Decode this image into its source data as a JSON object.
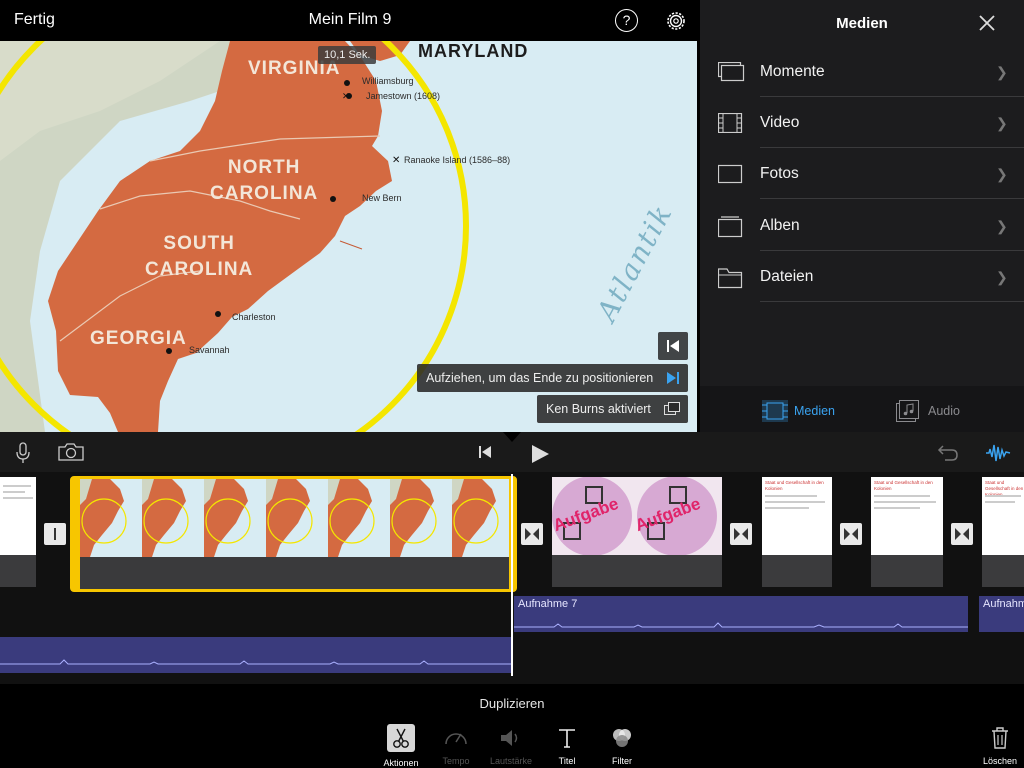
{
  "topbar": {
    "done_label": "Fertig",
    "title": "Mein Film 9",
    "help_label": "?"
  },
  "viewer": {
    "duration": "10,1 Sek.",
    "map": {
      "states": [
        "MARYLAND",
        "VIRGINIA",
        "NORTH\nCAROLINA",
        "SOUTH\nCAROLINA",
        "GEORGIA"
      ],
      "places": [
        "Williamsburg",
        "Jamestown (1608)",
        "Ranaoke Island (1586–88)",
        "New Bern",
        "Charleston",
        "Savannah"
      ],
      "ocean_label": "Atlantik"
    },
    "kb_hint": "Aufziehen, um das Ende zu positionieren",
    "kb_status": "Ken Burns aktiviert"
  },
  "media": {
    "title": "Medien",
    "items": [
      {
        "label": "Momente",
        "icon": "moments-icon"
      },
      {
        "label": "Video",
        "icon": "film-icon"
      },
      {
        "label": "Fotos",
        "icon": "photo-icon"
      },
      {
        "label": "Alben",
        "icon": "album-icon"
      },
      {
        "label": "Dateien",
        "icon": "folder-icon"
      }
    ],
    "tabs": [
      {
        "label": "Medien",
        "active": true
      },
      {
        "label": "Audio",
        "active": false
      }
    ],
    "accent_color": "#3aa3f0"
  },
  "timeline": {
    "clips": [
      {
        "kind": "document",
        "title": "Staat und Gesellschaft in den Kolonien"
      },
      {
        "kind": "map",
        "selected": true
      },
      {
        "kind": "image",
        "text": "Aufgabe"
      },
      {
        "kind": "document",
        "title": "Staat und Gesellschaft in den Kolonien"
      },
      {
        "kind": "document",
        "title": "Staat und Gesellschaft in den Kolonien"
      },
      {
        "kind": "document",
        "title": "Staat und Gesellschaft in den Kolonien"
      }
    ],
    "audio_clips": [
      {
        "label": "Aufnahme 7"
      },
      {
        "label": "Aufnahme"
      }
    ],
    "selection_color": "#f7c600",
    "audio_color": "#3a3b7d"
  },
  "bottom": {
    "action_label": "Duplizieren",
    "tools": [
      {
        "label": "Aktionen",
        "enabled": true
      },
      {
        "label": "Tempo",
        "enabled": false
      },
      {
        "label": "Lautstärke",
        "enabled": false
      },
      {
        "label": "Titel",
        "enabled": true
      },
      {
        "label": "Filter",
        "enabled": true
      }
    ],
    "delete_label": "Löschen"
  }
}
